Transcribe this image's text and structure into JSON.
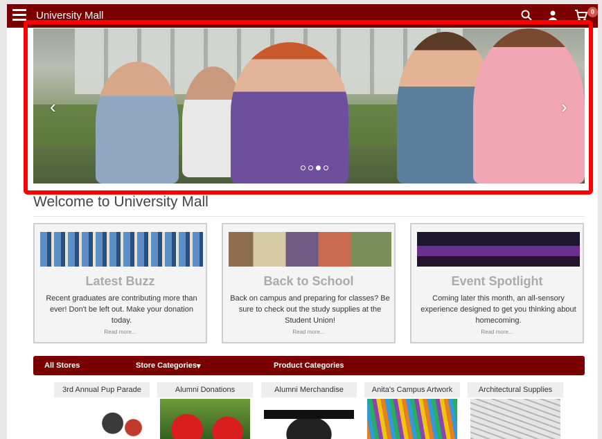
{
  "header": {
    "brand": "University Mall",
    "cart_count": "0",
    "icons": [
      "menu-icon",
      "search-icon",
      "user-icon",
      "cart-icon"
    ]
  },
  "carousel": {
    "prev_glyph": "‹",
    "next_glyph": "›",
    "slide_count": 4,
    "active_slide": 3
  },
  "welcome": {
    "title": "Welcome to University Mall"
  },
  "cards": [
    {
      "title": "Latest Buzz",
      "text": "Recent graduates are contributing more than ever! Don't be left out. Make your donation today.",
      "more": "Read more..."
    },
    {
      "title": "Back to School",
      "text": "Back on campus and preparing for classes? Be sure to check out the study supplies at the Student Union!",
      "more": "Read more..."
    },
    {
      "title": "Event Spotlight",
      "text": "Coming later this month, an all-sensory experience designed to get you thinking about homecoming.",
      "more": "Read more..."
    }
  ],
  "navbar": {
    "all_stores": "All Stores",
    "store_categories": "Store Categories",
    "store_categories_caret": "▾",
    "product_categories": "Product Categories"
  },
  "stores": [
    {
      "name": "3rd Annual Pup Parade"
    },
    {
      "name": "Alumni Donations"
    },
    {
      "name": "Alumni Merchandise"
    },
    {
      "name": "Anita's Campus Artwork"
    },
    {
      "name": "Architectural Supplies"
    }
  ],
  "colors": {
    "brand": "#7a0000",
    "highlight": "#ff0000",
    "badge": "#d9534f"
  }
}
